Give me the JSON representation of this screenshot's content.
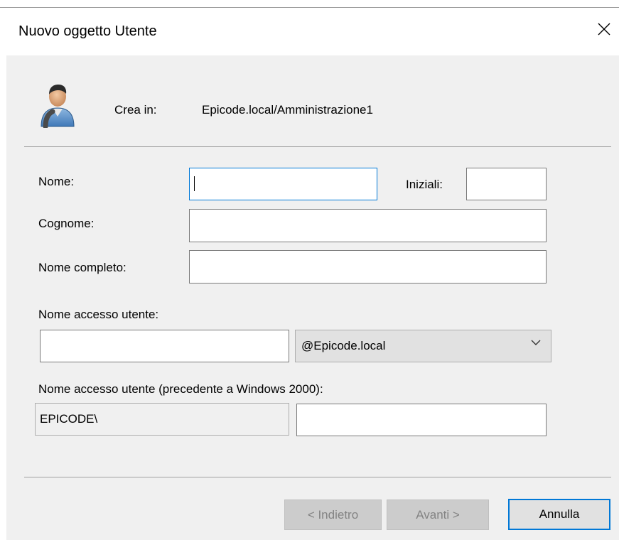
{
  "window": {
    "title": "Nuovo oggetto Utente"
  },
  "header": {
    "create_in_label": "Crea in:",
    "create_in_path": "Epicode.local/Amministrazione1"
  },
  "form": {
    "first_name": {
      "label": "Nome:",
      "value": ""
    },
    "initials": {
      "label": "Iniziali:",
      "value": ""
    },
    "last_name": {
      "label": "Cognome:",
      "value": ""
    },
    "full_name": {
      "label": "Nome completo:",
      "value": ""
    },
    "logon_name": {
      "label": "Nome accesso utente:",
      "value": ""
    },
    "domain_suffix": {
      "selected": "@Epicode.local"
    },
    "pre2000_logon": {
      "label": "Nome accesso utente (precedente a Windows 2000):",
      "domain_prefix": "EPICODE\\",
      "value": ""
    }
  },
  "buttons": {
    "back": "< Indietro",
    "next": "Avanti >",
    "cancel": "Annulla"
  },
  "colors": {
    "accent": "#0078d7",
    "dialog_bg": "#f0f0f0"
  },
  "icons": {
    "user": "user-icon",
    "close": "close-icon",
    "dropdown": "chevron-down-icon"
  }
}
